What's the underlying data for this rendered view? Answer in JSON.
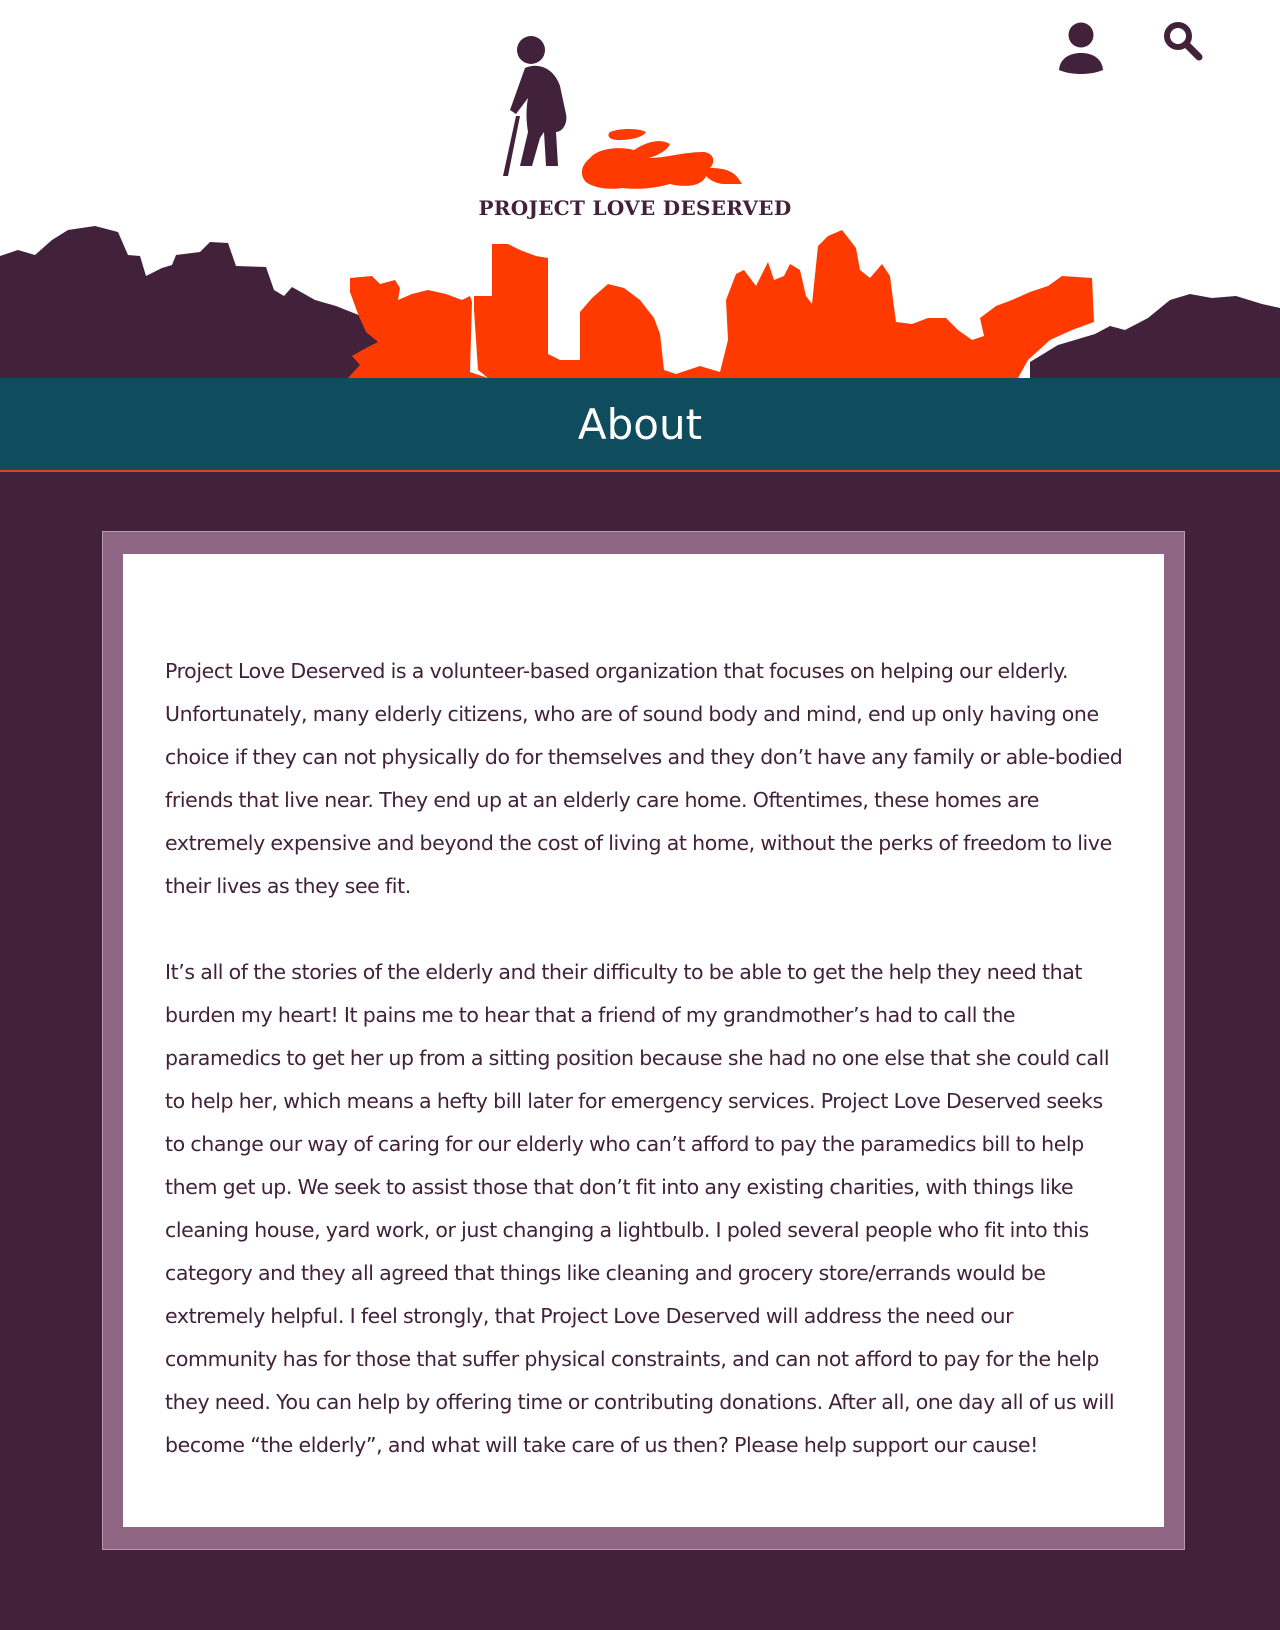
{
  "brand": {
    "logo_text": "PROJECT LOVE DESERVED",
    "logo_icon": "elderly-person-with-cane-and-fallen-person-icon",
    "colors": {
      "plum": "#42213a",
      "orange": "#ff3a00",
      "teal": "#0f4c5e",
      "mauve": "#8e6582"
    }
  },
  "header": {
    "account_icon": "user-icon",
    "search_icon": "search-icon"
  },
  "page": {
    "title": "About"
  },
  "about": {
    "paragraphs": [
      "Project Love Deserved is a volunteer-based organization that focuses on helping our elderly. Unfortunately, many elderly citizens, who are of sound body and mind, end up only having one choice if they can not physically do for themselves and they don’t have any family or able-bodied friends that live near.  They end up at an elderly care home. Oftentimes, these homes are extremely expensive and beyond the cost of living at home, without the perks of freedom to live their lives as they see fit.",
      "It’s all of the stories of the elderly and their difficulty to be able to get the help they need that burden my heart! It pains me to hear that a friend of my grandmother’s had to call the paramedics to get her up from a sitting position because she had no one else that she could call to help her, which means a hefty bill later for emergency services. Project Love Deserved seeks to change our way of caring for our elderly who can’t afford to pay the paramedics bill to help them get up. We seek to assist those that don’t fit into any existing charities, with things like cleaning house, yard work, or just changing a lightbulb. I poled several people who fit into this category and they all agreed that things like cleaning and grocery store/errands would be extremely helpful. I feel strongly, that Project Love Deserved will address the need our community has for those that suffer physical constraints, and can not afford to pay for the help they need. You can help by offering time or contributing donations. After all, one day all of us will become “the elderly”, and what will take care of us then? Please help support our cause!"
    ]
  }
}
